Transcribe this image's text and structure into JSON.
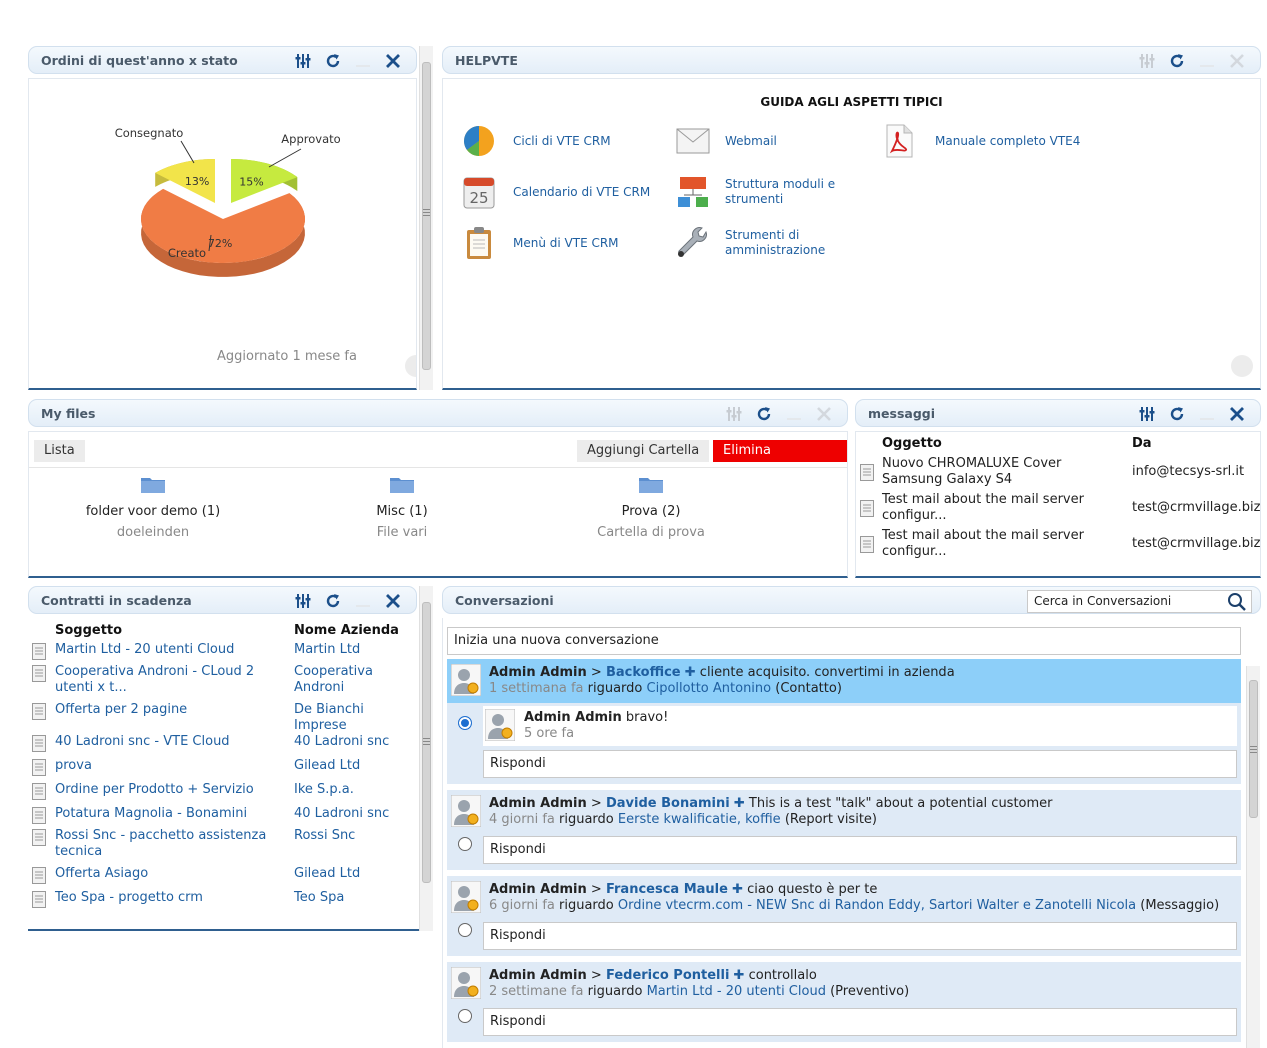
{
  "orders_widget": {
    "title": "Ordini di quest'anno x stato",
    "updated": "Aggiornato 1 mese fa"
  },
  "chart_data": {
    "type": "pie",
    "title": "",
    "slices": [
      {
        "label": "Creato",
        "value": 72,
        "color": "#f07c45"
      },
      {
        "label": "Consegnato",
        "value": 13,
        "color": "#f2e44a"
      },
      {
        "label": "Approvato",
        "value": 15,
        "color": "#c6ea3f"
      }
    ],
    "pct_labels": [
      "72%",
      "13%",
      "15%"
    ]
  },
  "help_widget": {
    "title": "HELPVTE",
    "heading": "GUIDA AGLI ASPETTI TIPICI",
    "items": [
      {
        "label": "Cicli di VTE CRM",
        "icon": "pie-chart-icon"
      },
      {
        "label": "Webmail",
        "icon": "envelope-icon"
      },
      {
        "label": "Manuale completo VTE4",
        "icon": "pdf-icon"
      },
      {
        "label": "Calendario di VTE CRM",
        "icon": "calendar-icon"
      },
      {
        "label": "Struttura moduli e strumenti",
        "icon": "structure-icon"
      },
      {
        "label": "Menù di VTE CRM",
        "icon": "clipboard-icon"
      },
      {
        "label": "Strumenti di amministrazione",
        "icon": "wrench-icon"
      }
    ],
    "calendar_day": "25"
  },
  "files_widget": {
    "title": "My files",
    "list_button": "Lista",
    "add_folder_button": "Aggiungi Cartella",
    "delete_folders_button": "Elimina Cartelle...",
    "delete_color": "#ee0000",
    "folders": [
      {
        "name": "folder voor demo (1)",
        "desc": "doeleinden"
      },
      {
        "name": "Misc (1)",
        "desc": "File vari"
      },
      {
        "name": "Prova (2)",
        "desc": "Cartella di prova"
      }
    ]
  },
  "messages_widget": {
    "title": "messaggi",
    "col_subject": "Oggetto",
    "col_from": "Da",
    "rows": [
      {
        "subject": "Nuovo CHROMALUXE Cover Samsung Galaxy S4",
        "from": "info@tecsys-srl.it"
      },
      {
        "subject": "Test mail about the mail server configur...",
        "from": "test@crmvillage.biz"
      },
      {
        "subject": "Test mail about the mail server configur...",
        "from": "test@crmvillage.biz"
      }
    ]
  },
  "contracts_widget": {
    "title": "Contratti in scadenza",
    "col_subject": "Soggetto",
    "col_company": "Nome Azienda",
    "rows": [
      {
        "subject": "Martin Ltd - 20 utenti Cloud",
        "company": "Martin Ltd"
      },
      {
        "subject": "Cooperativa Androni - CLoud 2 utenti x t...",
        "company": "Cooperativa Androni"
      },
      {
        "subject": "Offerta per 2 pagine",
        "company": "De Bianchi Imprese"
      },
      {
        "subject": "40 Ladroni snc - VTE Cloud",
        "company": "40 Ladroni snc"
      },
      {
        "subject": "prova",
        "company": "Gilead Ltd"
      },
      {
        "subject": "Ordine per Prodotto + Servizio",
        "company": "Ike S.p.a."
      },
      {
        "subject": "Potatura Magnolia - Bonamini",
        "company": "40 Ladroni snc"
      },
      {
        "subject": "Rossi Snc - pacchetto assistenza tecnica",
        "company": "Rossi Snc"
      },
      {
        "subject": "Offerta Asiago",
        "company": "Gilead Ltd"
      },
      {
        "subject": "Teo Spa - progetto crm",
        "company": "Teo Spa"
      }
    ]
  },
  "conversations_widget": {
    "title": "Conversazioni",
    "search_placeholder": "Cerca in Conversazioni",
    "new_conversation": "Inizia una nuova conversazione",
    "reply_label": "Rispondi",
    "regarding": "riguardo",
    "sep": ">",
    "highlight_color": "#8dcff9",
    "conversations": [
      {
        "author": "Admin Admin",
        "target": "Backoffice",
        "text": "cliente acquisito. convertimi in azienda",
        "time": "1 settimana fa",
        "about": "Cipollotto Antonino",
        "type": "(Contatto)",
        "reply": {
          "author": "Admin Admin",
          "text": "bravo!",
          "time": "5 ore fa"
        }
      },
      {
        "author": "Admin Admin",
        "target": "Davide Bonamini",
        "text": "This is a test \"talk\" about a potential customer",
        "time": "4 giorni fa",
        "about": "Eerste kwalificatie, koffie",
        "type": "(Report visite)"
      },
      {
        "author": "Admin Admin",
        "target": "Francesca Maule",
        "text": "ciao questo è per te",
        "time": "6 giorni fa",
        "about": "Ordine vtecrm.com - NEW Snc di Randon Eddy, Sartori Walter e Zanotelli Nicola",
        "type": "(Messaggio)"
      },
      {
        "author": "Admin Admin",
        "target": "Federico Pontelli",
        "text": "controllalo",
        "time": "2 settimane fa",
        "about": "Martin Ltd - 20 utenti Cloud",
        "type": "(Preventivo)"
      }
    ]
  }
}
